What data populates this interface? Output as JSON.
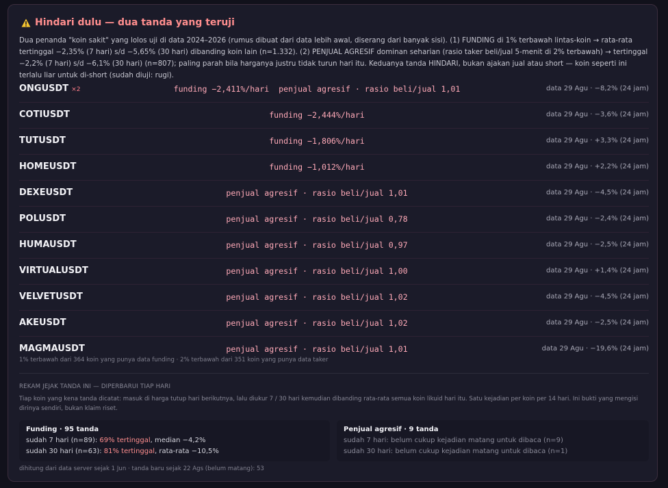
{
  "header": {
    "icon": "warning-icon",
    "title": "Hindari dulu — dua tanda yang teruji"
  },
  "intro": "Dua penanda \"koin sakit\" yang lolos uji di data 2024–2026 (rumus dibuat dari data lebih awal, diserang dari banyak sisi). (1) FUNDING di 1% terbawah lintas-koin → rata-rata tertinggal −2,35% (7 hari) s/d −5,65% (30 hari) dibanding koin lain (n=1.332). (2) PENJUAL AGRESIF dominan seharian (rasio taker beli/jual 5-menit di 2% terbawah) → tertinggal −2,2% (7 hari) s/d −6,1% (30 hari) (n=807); paling parah bila harganya justru tidak turun hari itu. Keduanya tanda HINDARI, bukan ajakan jual atau short — koin seperti ini terlalu liar untuk di-short (sudah diuji: rugi).",
  "rows": [
    {
      "symbol": "ONGUSDT",
      "mult": "×2",
      "signal": "funding −2,411%/hari  penjual agresif · rasio beli/jual 1,01",
      "meta": "data 29 Agu · −8,2% (24 jam)"
    },
    {
      "symbol": "COTIUSDT",
      "mult": "",
      "signal": "funding −2,444%/hari",
      "meta": "data 29 Agu · −3,6% (24 jam)"
    },
    {
      "symbol": "TUTUSDT",
      "mult": "",
      "signal": "funding −1,806%/hari",
      "meta": "data 29 Agu · +3,3% (24 jam)"
    },
    {
      "symbol": "HOMEUSDT",
      "mult": "",
      "signal": "funding −1,012%/hari",
      "meta": "data 29 Agu · +2,2% (24 jam)"
    },
    {
      "symbol": "DEXEUSDT",
      "mult": "",
      "signal": "penjual agresif · rasio beli/jual 1,01",
      "meta": "data 29 Agu · −4,5% (24 jam)"
    },
    {
      "symbol": "POLUSDT",
      "mult": "",
      "signal": "penjual agresif · rasio beli/jual 0,78",
      "meta": "data 29 Agu · −2,4% (24 jam)"
    },
    {
      "symbol": "HUMAUSDT",
      "mult": "",
      "signal": "penjual agresif · rasio beli/jual 0,97",
      "meta": "data 29 Agu · −2,5% (24 jam)"
    },
    {
      "symbol": "VIRTUALUSDT",
      "mult": "",
      "signal": "penjual agresif · rasio beli/jual 1,00",
      "meta": "data 29 Agu · +1,4% (24 jam)"
    },
    {
      "symbol": "VELVETUSDT",
      "mult": "",
      "signal": "penjual agresif · rasio beli/jual 1,02",
      "meta": "data 29 Agu · −4,5% (24 jam)"
    },
    {
      "symbol": "AKEUSDT",
      "mult": "",
      "signal": "penjual agresif · rasio beli/jual 1,02",
      "meta": "data 29 Agu · −2,5% (24 jam)"
    },
    {
      "symbol": "MAGMAUSDT",
      "mult": "",
      "signal": "penjual agresif · rasio beli/jual 1,01",
      "meta": "data 29 Agu · −19,6% (24 jam)"
    }
  ],
  "footnote": "1% terbawah dari 364 koin yang punya data funding · 2% terbawah dari 351 koin yang punya data taker",
  "track_record": {
    "title": "REKAM JEJAK TANDA INI — DIPERBARUI TIAP HARI",
    "description": "Tiap koin yang kena tanda dicatat: masuk di harga tutup hari berikutnya, lalu diukur 7 / 30 hari kemudian dibanding rata-rata semua koin likuid hari itu. Satu kejadian per koin per 14 hari. Ini bukti yang mengisi dirinya sendiri, bukan klaim riset.",
    "funding": {
      "title": "Funding · 95 tanda",
      "line1_prefix": "sudah 7 hari (n=89): ",
      "line1_highlight": "69% tertinggal",
      "line1_suffix": ", median −4,2%",
      "line2_prefix": "sudah 30 hari (n=63): ",
      "line2_highlight": "81% tertinggal",
      "line2_suffix": ", rata-rata −10,5%"
    },
    "seller": {
      "title": "Penjual agresif · 9 tanda",
      "line1": "sudah 7 hari: belum cukup kejadian matang untuk dibaca (n=9)",
      "line2": "sudah 30 hari: belum cukup kejadian matang untuk dibaca (n=1)"
    },
    "footer": "dihitung dari data server sejak 1 Jun · tanda baru sejak 22 Ags (belum matang): 53"
  },
  "colors": {
    "accent": "#ff8e8e",
    "signal": "#ffaab8",
    "warning_icon": "#f4c430"
  }
}
